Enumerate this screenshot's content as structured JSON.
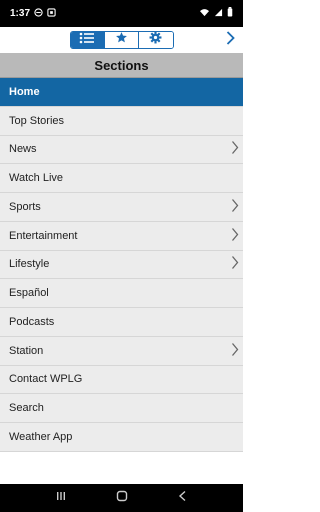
{
  "status": {
    "time": "1:37"
  },
  "toolbar": {
    "tabs": [
      {
        "icon": "list-icon",
        "active": true
      },
      {
        "icon": "star-icon",
        "active": false
      },
      {
        "icon": "gear-icon",
        "active": false
      }
    ]
  },
  "header": {
    "title": "Sections"
  },
  "sections": {
    "items": [
      {
        "label": "Home",
        "active": true,
        "chevron": false
      },
      {
        "label": "Top Stories",
        "chevron": false
      },
      {
        "label": "News",
        "chevron": true
      },
      {
        "label": "Watch Live",
        "chevron": false
      },
      {
        "label": "Sports",
        "chevron": true
      },
      {
        "label": "Entertainment",
        "chevron": true
      },
      {
        "label": "Lifestyle",
        "chevron": true
      },
      {
        "label": "Español",
        "chevron": false
      },
      {
        "label": "Podcasts",
        "chevron": false
      },
      {
        "label": "Station",
        "chevron": true
      },
      {
        "label": "Contact WPLG",
        "chevron": false
      },
      {
        "label": "Search",
        "chevron": false
      },
      {
        "label": "Weather App",
        "chevron": false
      }
    ]
  },
  "colors": {
    "accent": "#1b6cb3",
    "active_row": "#1366a3",
    "header_bg": "#b9b9b9"
  }
}
